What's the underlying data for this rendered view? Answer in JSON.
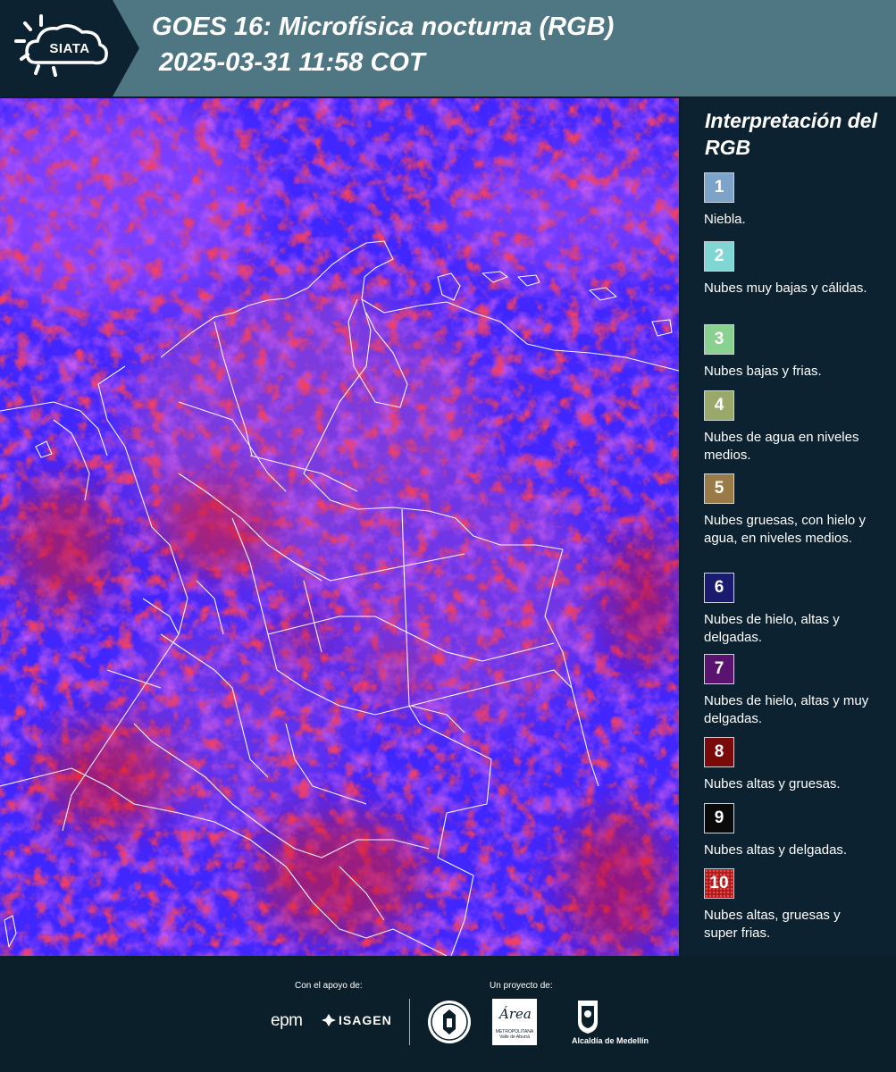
{
  "header": {
    "logo": "SIATA",
    "title_line1": "GOES 16: Microfísica nocturna (RGB)",
    "title_line2": "2025-03-31 11:58 COT",
    "background": "#4e7683"
  },
  "map": {
    "description_colors": {
      "base": "#4127ff",
      "magenta": "#8a2de8",
      "red": "#e01414",
      "borders": "#ffffff"
    }
  },
  "legend": {
    "title": "Interpretación del RGB",
    "items": [
      {
        "number": "1",
        "label": "Niebla.",
        "color": "#7ea3c8"
      },
      {
        "number": "2",
        "label": "Nubes muy bajas y cálidas.",
        "color": "#7fd6d2"
      },
      {
        "number": "3",
        "label": "Nubes bajas y frias.",
        "color": "#8ad08f"
      },
      {
        "number": "4",
        "label": "Nubes de agua en niveles medios.",
        "color": "#9aa86a"
      },
      {
        "number": "5",
        "label": "Nubes gruesas, con hielo y agua, en niveles medios.",
        "color": "#9a7a47"
      },
      {
        "number": "6",
        "label": "Nubes de hielo, altas y delgadas.",
        "color": "#1a1a6e"
      },
      {
        "number": "7",
        "label": "Nubes de hielo, altas y muy delgadas.",
        "color": "#5a1470"
      },
      {
        "number": "8",
        "label": "Nubes altas y gruesas.",
        "color": "#7a0a0a"
      },
      {
        "number": "9",
        "label": "Nubes altas y delgadas.",
        "color": "#0a0a0a"
      },
      {
        "number": "10",
        "label": "Nubes altas, gruesas y super frias.",
        "color": "#b01818"
      }
    ]
  },
  "footer": {
    "support_label": "Con el apoyo de:",
    "project_label": "Un proyecto de:",
    "sponsor_1": "epm",
    "sponsor_2": "ISAGEN",
    "partner_1": "Área",
    "partner_1_sub": "METROPOLITANA Valle de Aburrá",
    "partner_2": "Alcaldía de Medellín"
  }
}
